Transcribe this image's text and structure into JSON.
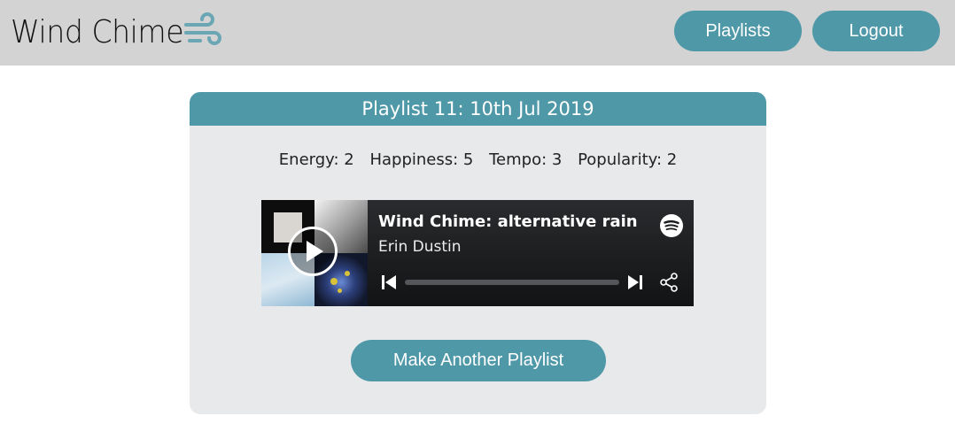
{
  "brand": {
    "name": "Wind Chime",
    "icon": "wind-icon",
    "accent_color": "#4f98a8"
  },
  "nav": {
    "playlists_label": "Playlists",
    "logout_label": "Logout"
  },
  "playlist": {
    "title": "Playlist 11: 10th Jul 2019",
    "stats": [
      {
        "label": "Energy",
        "value": "2",
        "text": "Energy: 2"
      },
      {
        "label": "Happiness",
        "value": "5",
        "text": "Happiness: 5"
      },
      {
        "label": "Tempo",
        "value": "3",
        "text": "Tempo: 3"
      },
      {
        "label": "Popularity",
        "value": "2",
        "text": "Popularity: 2"
      }
    ]
  },
  "player": {
    "title": "Wind Chime: alternative rain",
    "artist": "Erin Dustin",
    "progress": 0,
    "icons": [
      "play-icon",
      "spotify-icon",
      "previous-icon",
      "next-icon",
      "share-icon"
    ]
  },
  "actions": {
    "make_another_label": "Make Another Playlist"
  }
}
